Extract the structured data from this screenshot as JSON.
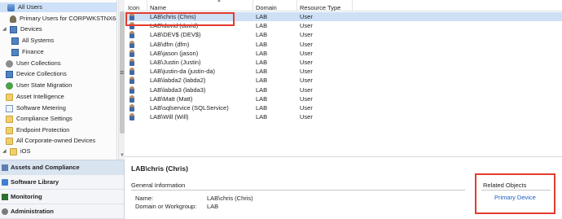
{
  "nav_tree": [
    {
      "label": "All Users",
      "icon": "users-icon",
      "selected": true
    },
    {
      "label": "Primary Users for CORPWKSTNX64",
      "icon": "user-icon"
    },
    {
      "label": "Devices",
      "icon": "devices-icon"
    },
    {
      "label": "All Systems",
      "icon": "devices-icon"
    },
    {
      "label": "Finance",
      "icon": "devices-icon"
    },
    {
      "label": "User Collections",
      "icon": "gear-icon"
    },
    {
      "label": "Device Collections",
      "icon": "gear-icon"
    },
    {
      "label": "User State Migration",
      "icon": "migration-icon"
    },
    {
      "label": "Asset Intelligence",
      "icon": "folder-icon"
    },
    {
      "label": "Software Metering",
      "icon": "page-icon"
    },
    {
      "label": "Compliance Settings",
      "icon": "folder-icon"
    },
    {
      "label": "Endpoint Protection",
      "icon": "folder-icon"
    },
    {
      "label": "All Corporate-owned Devices",
      "icon": "folder-icon"
    },
    {
      "label": "iOS",
      "icon": "folder-icon"
    }
  ],
  "workspaces": [
    {
      "label": "Assets and Compliance",
      "active": true
    },
    {
      "label": "Software Library"
    },
    {
      "label": "Monitoring"
    },
    {
      "label": "Administration"
    }
  ],
  "list": {
    "columns": [
      "Icon",
      "Name",
      "Domain",
      "Resource Type"
    ],
    "rows": [
      {
        "name": "LAB\\chris (Chris)",
        "domain": "LAB",
        "type": "User",
        "selected": true
      },
      {
        "name": "LAB\\david (david)",
        "domain": "LAB",
        "type": "User"
      },
      {
        "name": "LAB\\DEV$ (DEV$)",
        "domain": "LAB",
        "type": "User"
      },
      {
        "name": "LAB\\dfm (dfm)",
        "domain": "LAB",
        "type": "User"
      },
      {
        "name": "LAB\\jason (jason)",
        "domain": "LAB",
        "type": "User"
      },
      {
        "name": "LAB\\Justin (Justin)",
        "domain": "LAB",
        "type": "User"
      },
      {
        "name": "LAB\\justin-da (justin-da)",
        "domain": "LAB",
        "type": "User"
      },
      {
        "name": "LAB\\labda2 (labda2)",
        "domain": "LAB",
        "type": "User"
      },
      {
        "name": "LAB\\labda3 (labda3)",
        "domain": "LAB",
        "type": "User"
      },
      {
        "name": "LAB\\Matt (Matt)",
        "domain": "LAB",
        "type": "User"
      },
      {
        "name": "LAB\\sqlservice (SQLService)",
        "domain": "LAB",
        "type": "User"
      },
      {
        "name": "LAB\\Will (Will)",
        "domain": "LAB",
        "type": "User"
      }
    ]
  },
  "details": {
    "title": "LAB\\chris (Chris)",
    "general_heading": "General Information",
    "name_label": "Name:",
    "name_value": "LAB\\chris (Chris)",
    "domain_label": "Domain or Workgroup:",
    "domain_value": "LAB",
    "related_heading": "Related Objects",
    "primary_device_link": "Primary Device"
  },
  "colors": {
    "selection": "#cde0f6",
    "highlight_box": "#e23b2e",
    "link": "#1a5fbf"
  }
}
